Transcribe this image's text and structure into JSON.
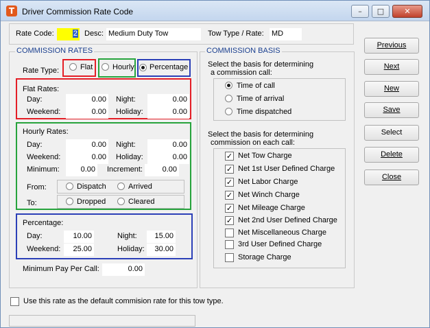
{
  "window": {
    "title": "Driver Commission Rate Code"
  },
  "header": {
    "rate_code_label": "Rate Code:",
    "rate_code_value": "2",
    "desc_label": "Desc:",
    "desc_value": "Medium Duty Tow",
    "tow_type_label": "Tow Type / Rate:",
    "tow_type_value": "MD"
  },
  "commission_rates": {
    "title": "COMMISSION RATES",
    "rate_type_label": "Rate Type:",
    "rate_types": [
      {
        "label": "Flat",
        "selected": false
      },
      {
        "label": "Hourly",
        "selected": false
      },
      {
        "label": "Percentage",
        "selected": true
      }
    ],
    "flat": {
      "title": "Flat Rates:",
      "day_label": "Day:",
      "day": "0.00",
      "night_label": "Night:",
      "night": "0.00",
      "weekend_label": "Weekend:",
      "weekend": "0.00",
      "holiday_label": "Holiday:",
      "holiday": "0.00"
    },
    "hourly": {
      "title": "Hourly Rates:",
      "day_label": "Day:",
      "day": "0.00",
      "night_label": "Night:",
      "night": "0.00",
      "weekend_label": "Weekend:",
      "weekend": "0.00",
      "holiday_label": "Holiday:",
      "holiday": "0.00",
      "minimum_label": "Minimum:",
      "minimum": "0.00",
      "increment_label": "Increment:",
      "increment": "0.00",
      "from_label": "From:",
      "from_options": [
        {
          "label": "Dispatch",
          "selected": false
        },
        {
          "label": "Arrived",
          "selected": false
        }
      ],
      "to_label": "To:",
      "to_options": [
        {
          "label": "Dropped",
          "selected": false
        },
        {
          "label": "Cleared",
          "selected": false
        }
      ]
    },
    "percentage": {
      "title": "Percentage:",
      "day_label": "Day:",
      "day": "10.00",
      "night_label": "Night:",
      "night": "15.00",
      "weekend_label": "Weekend:",
      "weekend": "25.00",
      "holiday_label": "Holiday:",
      "holiday": "30.00"
    },
    "min_pay_label": "Minimum Pay Per Call:",
    "min_pay_value": "0.00"
  },
  "commission_basis": {
    "title": "COMMISSION BASIS",
    "basis_prompt_line1": "Select the basis for determining",
    "basis_prompt_line2": "a commission call:",
    "basis_options": [
      {
        "label": "Time of call",
        "selected": true
      },
      {
        "label": "Time of arrival",
        "selected": false
      },
      {
        "label": "Time dispatched",
        "selected": false
      }
    ],
    "charges_prompt_line1": "Select the basis for determining",
    "charges_prompt_line2": "commission on each call:",
    "charges": [
      {
        "label": "Net Tow Charge",
        "checked": true
      },
      {
        "label": "Net 1st User Defined Charge",
        "checked": true
      },
      {
        "label": "Net Labor Charge",
        "checked": true
      },
      {
        "label": "Net Winch Charge",
        "checked": true
      },
      {
        "label": "Net Mileage Charge",
        "checked": true
      },
      {
        "label": "Net 2nd User Defined Charge",
        "checked": true
      },
      {
        "label": "Net Miscellaneous Charge",
        "checked": false
      },
      {
        "label": "3rd User Defined Charge",
        "checked": false
      },
      {
        "label": "Storage Charge",
        "checked": false
      }
    ]
  },
  "buttons": {
    "previous": "Previous",
    "next": "Next",
    "new": "New",
    "save": "Save",
    "select": "Select",
    "delete": "Delete",
    "close": "Close"
  },
  "footer": {
    "default_checkbox_label": "Use this rate as the default commision rate for this tow type.",
    "default_checked": false
  },
  "colors": {
    "title_bar": "#c9daf0",
    "highlight_red": "#e41e26",
    "highlight_green": "#26a33c",
    "highlight_blue": "#2b3fb7",
    "rate_code_bg": "#ffff00",
    "group_title": "#1a3f8f"
  }
}
